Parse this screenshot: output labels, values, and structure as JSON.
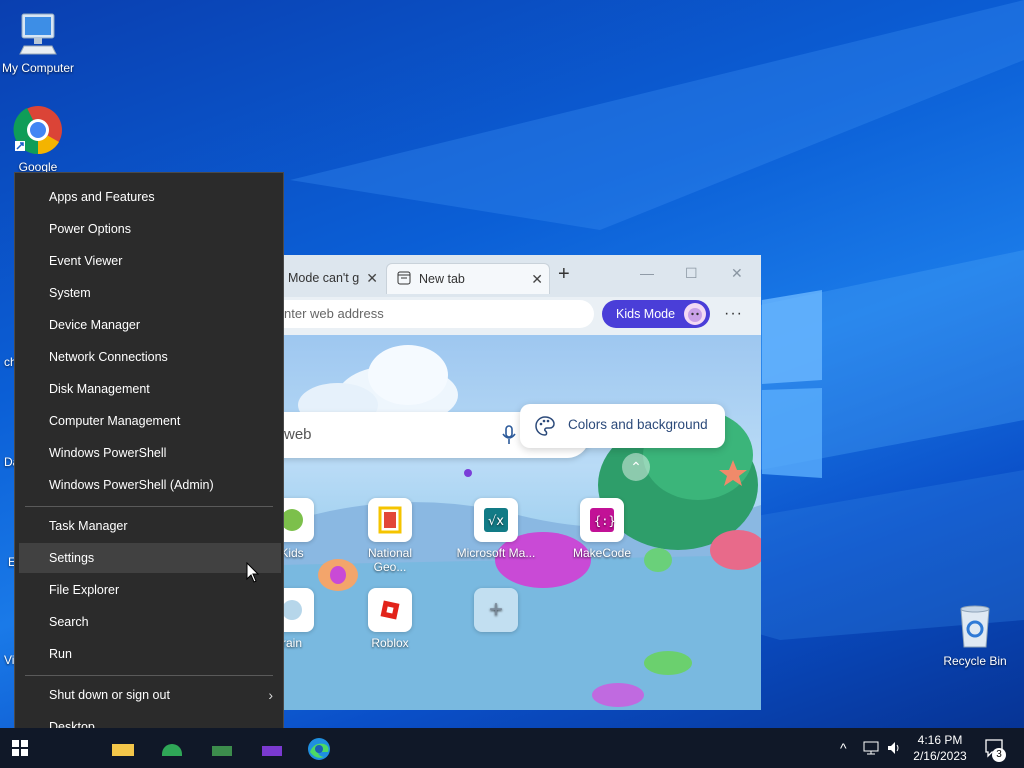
{
  "desktop": {
    "icons": [
      {
        "label": "My Computer",
        "icon": "computer-icon"
      },
      {
        "label": "Google",
        "icon": "chrome-icon"
      },
      {
        "label": "Recycle Bin",
        "icon": "recycle-bin-icon"
      }
    ],
    "edge_labels": [
      "ch",
      "Da",
      "E",
      "Vi"
    ]
  },
  "browser": {
    "tabs": [
      {
        "label": "Mode can't g",
        "active": false
      },
      {
        "label": "New tab",
        "active": true
      }
    ],
    "address_placeholder": "nter web address",
    "kids_mode_label": "Kids Mode",
    "search_placeholder": "web",
    "colors_button_label": "Colors and background",
    "tiles": [
      {
        "label": "Kids",
        "icon": "kids-site-icon"
      },
      {
        "label": "National Geo...",
        "icon": "national-geographic-icon"
      },
      {
        "label": "Microsoft Ma...",
        "icon": "microsoft-math-icon"
      },
      {
        "label": "MakeCode",
        "icon": "makecode-icon"
      },
      {
        "label": "rain",
        "icon": "brain-site-icon"
      },
      {
        "label": "Roblox",
        "icon": "roblox-icon"
      },
      {
        "label": "",
        "icon": "add-icon"
      }
    ]
  },
  "context_menu": {
    "groups": [
      [
        "Apps and Features",
        "Power Options",
        "Event Viewer",
        "System",
        "Device Manager",
        "Network Connections",
        "Disk Management",
        "Computer Management",
        "Windows PowerShell",
        "Windows PowerShell (Admin)"
      ],
      [
        "Task Manager",
        "Settings",
        "File Explorer",
        "Search",
        "Run"
      ],
      [
        "Shut down or sign out",
        "Desktop"
      ]
    ],
    "hovered": "Settings"
  },
  "taskbar": {
    "time": "4:16 PM",
    "date": "2/16/2023",
    "notification_count": "3"
  },
  "colors": {
    "kids_mode": "#4a3ed8",
    "menu_bg": "#2b2b2b",
    "taskbar_bg": "#101828"
  }
}
